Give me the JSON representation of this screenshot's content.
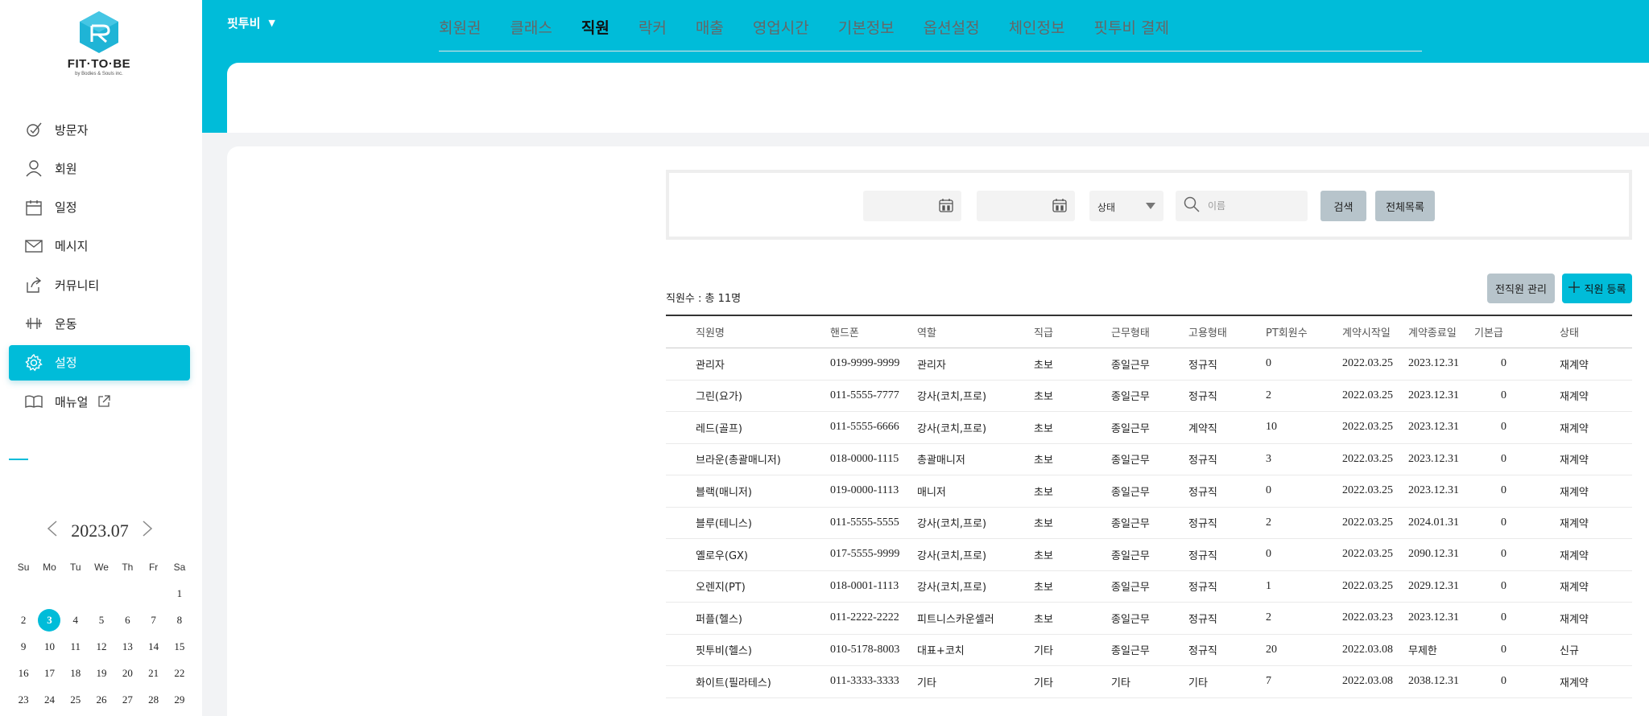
{
  "brand": {
    "logo_text": "FIT·TO·BE",
    "logo_sub": "by Bodies & Souls inc."
  },
  "header": {
    "gym_name": "핏투비"
  },
  "sidebar": {
    "items": [
      {
        "label": "방문자",
        "icon": "visitor-check-icon"
      },
      {
        "label": "회원",
        "icon": "user-icon"
      },
      {
        "label": "일정",
        "icon": "calendar-icon"
      },
      {
        "label": "메시지",
        "icon": "envelope-icon"
      },
      {
        "label": "커뮤니티",
        "icon": "share-icon"
      },
      {
        "label": "운동",
        "icon": "dumbbell-icon"
      },
      {
        "label": "설정",
        "icon": "gear-icon",
        "active": true
      },
      {
        "label": "매뉴얼",
        "icon": "book-icon"
      }
    ]
  },
  "calendar": {
    "title": "2023.07",
    "weekdays": [
      "Su",
      "Mo",
      "Tu",
      "We",
      "Th",
      "Fr",
      "Sa"
    ],
    "first_weekday_index": 6,
    "days_shown": 29,
    "today": 3
  },
  "tabs": [
    {
      "label": "회원권"
    },
    {
      "label": "클래스"
    },
    {
      "label": "직원",
      "active": true
    },
    {
      "label": "락커"
    },
    {
      "label": "매출"
    },
    {
      "label": "영업시간"
    },
    {
      "label": "기본정보"
    },
    {
      "label": "옵션설정"
    },
    {
      "label": "체인정보"
    },
    {
      "label": "핏투비 결제"
    }
  ],
  "filter": {
    "status_label": "상태",
    "search_placeholder": "이름",
    "search_button": "검색",
    "all_button": "전체목록"
  },
  "staff": {
    "count_label": "직원수 : 총 11명",
    "retired_button": "전직원 관리",
    "add_button": "직원 등록",
    "columns": [
      "직원명",
      "핸드폰",
      "역할",
      "직급",
      "근무형태",
      "고용형태",
      "PT회원수",
      "계약시작일",
      "계약종료일",
      "기본급",
      "상태"
    ],
    "rows": [
      [
        "관리자",
        "019-9999-9999",
        "관리자",
        "초보",
        "종일근무",
        "정규직",
        "0",
        "2022.03.25",
        "2023.12.31",
        "0",
        "재계약"
      ],
      [
        "그린(요가)",
        "011-5555-7777",
        "강사(코치,프로)",
        "초보",
        "종일근무",
        "정규직",
        "2",
        "2022.03.25",
        "2023.12.31",
        "0",
        "재계약"
      ],
      [
        "레드(골프)",
        "011-5555-6666",
        "강사(코치,프로)",
        "초보",
        "종일근무",
        "계약직",
        "10",
        "2022.03.25",
        "2023.12.31",
        "0",
        "재계약"
      ],
      [
        "브라운(총괄매니저)",
        "018-0000-1115",
        "총괄매니저",
        "초보",
        "종일근무",
        "정규직",
        "3",
        "2022.03.25",
        "2023.12.31",
        "0",
        "재계약"
      ],
      [
        "블랙(매니저)",
        "019-0000-1113",
        "매니저",
        "초보",
        "종일근무",
        "정규직",
        "0",
        "2022.03.25",
        "2023.12.31",
        "0",
        "재계약"
      ],
      [
        "블루(테니스)",
        "011-5555-5555",
        "강사(코치,프로)",
        "초보",
        "종일근무",
        "정규직",
        "2",
        "2022.03.25",
        "2024.01.31",
        "0",
        "재계약"
      ],
      [
        "옐로우(GX)",
        "017-5555-9999",
        "강사(코치,프로)",
        "초보",
        "종일근무",
        "정규직",
        "0",
        "2022.03.25",
        "2090.12.31",
        "0",
        "재계약"
      ],
      [
        "오렌지(PT)",
        "018-0001-1113",
        "강사(코치,프로)",
        "초보",
        "종일근무",
        "정규직",
        "1",
        "2022.03.25",
        "2029.12.31",
        "0",
        "재계약"
      ],
      [
        "퍼플(헬스)",
        "011-2222-2222",
        "피트니스카운셀러",
        "초보",
        "종일근무",
        "정규직",
        "2",
        "2022.03.23",
        "2023.12.31",
        "0",
        "재계약"
      ],
      [
        "핏투비(헬스)",
        "010-5178-8003",
        "대표+코치",
        "기타",
        "종일근무",
        "정규직",
        "20",
        "2022.03.08",
        "무제한",
        "0",
        "신규"
      ],
      [
        "화이트(필라테스)",
        "011-3333-3333",
        "기타",
        "기타",
        "기타",
        "기타",
        "7",
        "2022.03.08",
        "2038.12.31",
        "0",
        "재계약"
      ]
    ]
  },
  "colors": {
    "accent": "#00bcd9",
    "button_gray": "#b7c4cb"
  }
}
